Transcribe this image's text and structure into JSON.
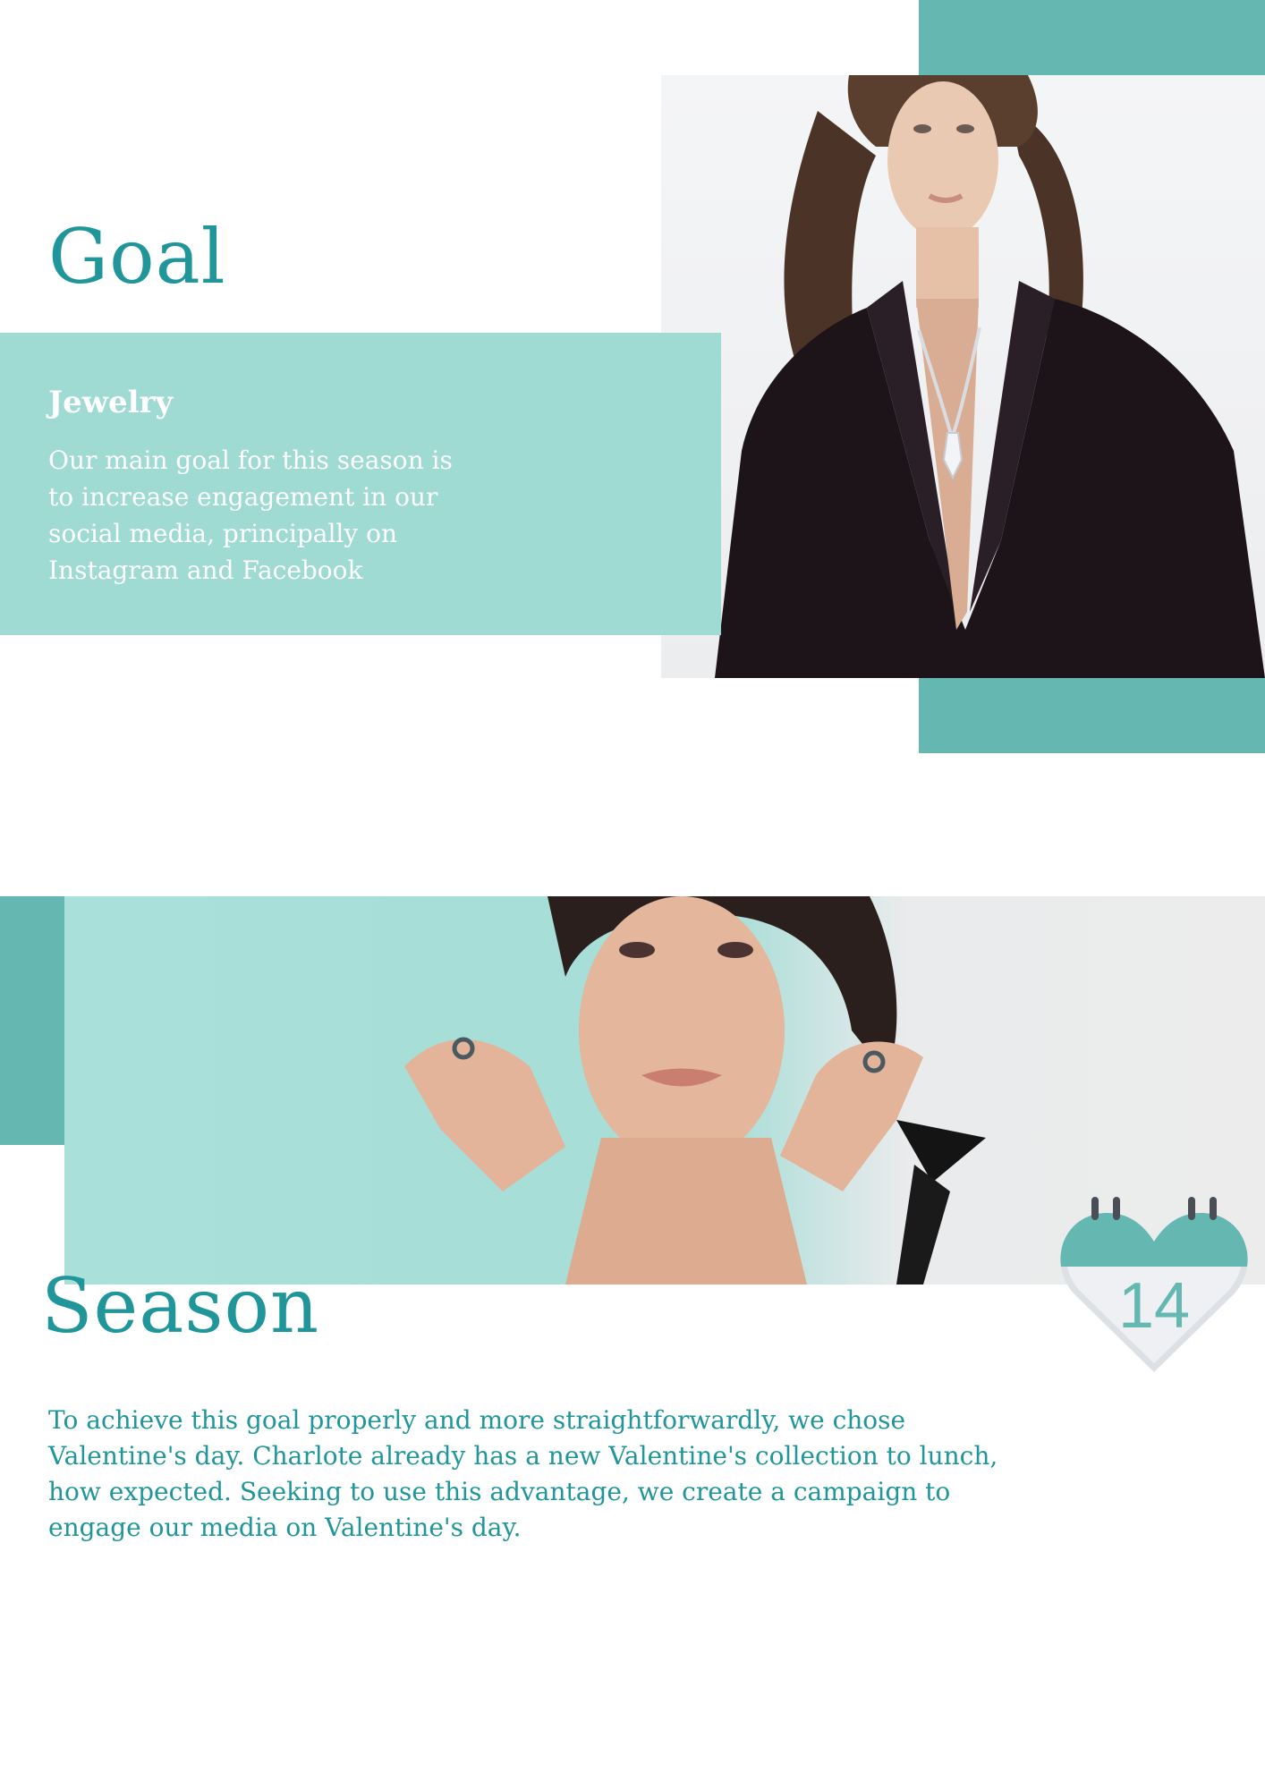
{
  "goal": {
    "title": "Goal",
    "subheading": "Jewelry",
    "body": "Our main goal for this season is to increase engagement in our social media, principally on Instagram and Facebook"
  },
  "season": {
    "title": "Season",
    "body": "To achieve this goal properly and more straightforwardly, we chose Valentine's day. Charlote already has a new Valentine's collection to lunch, how expected. Seeking to use this advantage, we create a campaign to engage our media on Valentine's day.",
    "calendar_day": "14"
  },
  "colors": {
    "accent": "#65b8b1",
    "panel": "#9bd8d1",
    "heading": "#20969a"
  },
  "icons": {
    "calendar": "heart-calendar-icon"
  }
}
